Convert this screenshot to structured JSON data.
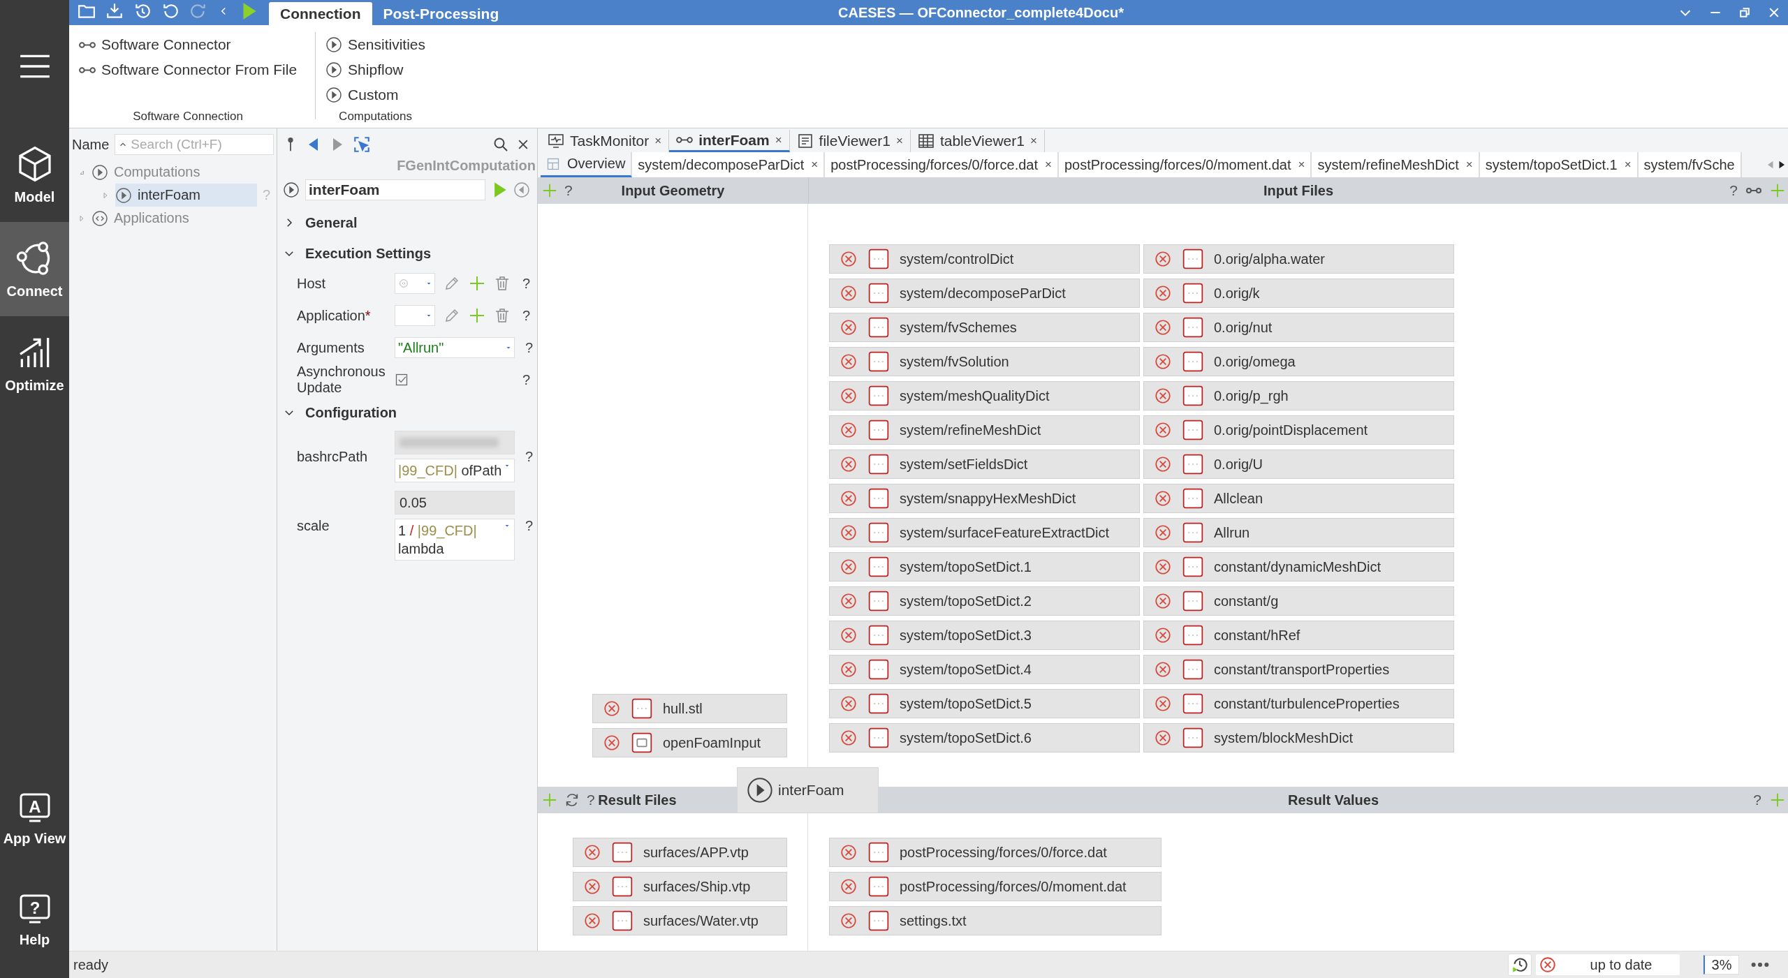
{
  "window": {
    "title": "CAESES — OFConnector_complete4Docu*"
  },
  "quick_access": [
    {
      "disabled": false
    },
    {
      "disabled": false
    },
    {
      "disabled": false
    },
    {
      "disabled": false
    },
    {
      "disabled": true
    },
    {
      "disabled": false
    },
    {
      "disabled": false
    }
  ],
  "ribbon_tabs": [
    {
      "label": "Connection",
      "selected": true
    },
    {
      "label": "Post-Processing",
      "selected": false
    }
  ],
  "ribbon_groups": [
    {
      "title": "Software Connection",
      "items": [
        {
          "label": "Software Connector"
        },
        {
          "label": "Software Connector From File"
        }
      ]
    },
    {
      "title": "Computations",
      "items": [
        {
          "label": "Sensitivities"
        },
        {
          "label": "Shipflow"
        },
        {
          "label": "Custom"
        }
      ]
    }
  ],
  "sidebar": {
    "top": [
      {
        "label": "Model",
        "selected": false
      },
      {
        "label": "Connect",
        "selected": true
      },
      {
        "label": "Optimize",
        "selected": false
      }
    ],
    "bottom": [
      {
        "label": "App View",
        "icon_text": "A",
        "selected": false
      },
      {
        "label": "Help",
        "icon_text": "?",
        "selected": false
      }
    ]
  },
  "tree": {
    "column": "Name",
    "search_placeholder": "Search (Ctrl+F)",
    "help": "?",
    "items": [
      {
        "label": "Computations",
        "kind": "computation",
        "expanded": true,
        "selected": false,
        "children": [
          {
            "label": "interFoam",
            "kind": "computation",
            "expanded": false,
            "selected": true
          }
        ]
      },
      {
        "label": "Applications",
        "kind": "application",
        "expanded": false,
        "selected": false
      }
    ]
  },
  "properties": {
    "type_label": "FGenIntComputation",
    "name": "interFoam",
    "sections": [
      {
        "title": "General",
        "expanded": false
      },
      {
        "title": "Execution Settings",
        "expanded": true,
        "rows": [
          {
            "kind": "host-select",
            "label": "Host",
            "help": "?"
          },
          {
            "kind": "select",
            "label": "Application",
            "required_mark": "*",
            "help": "?"
          },
          {
            "kind": "text",
            "label": "Arguments",
            "value": "\"Allrun\"",
            "help": "?"
          },
          {
            "kind": "checkbox",
            "label": "Asynchronous Update",
            "checked": true,
            "help": "?"
          }
        ]
      },
      {
        "title": "Configuration",
        "expanded": true,
        "rows": [
          {
            "kind": "expression",
            "label": "bashrcPath",
            "preview_hidden": true,
            "parts": [
              {
                "kind": "reference",
                "text": "|99_CFD|"
              },
              {
                "kind": "plain",
                "text": "ofPath"
              }
            ],
            "help": "?"
          },
          {
            "kind": "expression",
            "label": "scale",
            "preview_hidden": false,
            "preview": "0.05",
            "parts": [
              {
                "kind": "plain",
                "text": "1"
              },
              {
                "kind": "operator",
                "text": "/"
              },
              {
                "kind": "reference",
                "text": "|99_CFD|"
              },
              {
                "kind": "plain",
                "text": "lambda"
              }
            ],
            "help": "?"
          }
        ]
      }
    ]
  },
  "editor_tabs": [
    {
      "label": "TaskMonitor",
      "kind": "monitor",
      "selected": false,
      "close": "×"
    },
    {
      "label": "interFoam",
      "kind": "connector",
      "selected": true,
      "close": "×"
    },
    {
      "label": "fileViewer1",
      "kind": "file",
      "selected": false,
      "close": "×"
    },
    {
      "label": "tableViewer1",
      "kind": "table",
      "selected": false,
      "close": "×"
    }
  ],
  "view_tabs": [
    {
      "label": "Overview",
      "kind": "overview",
      "selected": true
    },
    {
      "label": "system/decomposeParDict",
      "selected": false,
      "close": "×"
    },
    {
      "label": "postProcessing/forces/0/force.dat",
      "selected": false,
      "close": "×"
    },
    {
      "label": "postProcessing/forces/0/moment.dat",
      "selected": false,
      "close": "×"
    },
    {
      "label": "system/refineMeshDict",
      "selected": false,
      "close": "×"
    },
    {
      "label": "system/topoSetDict.1",
      "selected": false,
      "close": "×"
    },
    {
      "label": "system/fvSche",
      "selected": false
    }
  ],
  "input_geometry": {
    "title": "Input Geometry",
    "help": "?",
    "items": [
      {
        "label": "hull.stl",
        "kind": "file"
      },
      {
        "label": "openFoamInput",
        "kind": "object"
      }
    ]
  },
  "input_files": {
    "title": "Input Files",
    "help": "?",
    "items": [
      {
        "label": "system/controlDict"
      },
      {
        "label": "0.orig/alpha.water"
      },
      {
        "label": "system/decomposeParDict"
      },
      {
        "label": "0.orig/k"
      },
      {
        "label": "system/fvSchemes"
      },
      {
        "label": "0.orig/nut"
      },
      {
        "label": "system/fvSolution"
      },
      {
        "label": "0.orig/omega"
      },
      {
        "label": "system/meshQualityDict"
      },
      {
        "label": "0.orig/p_rgh"
      },
      {
        "label": "system/refineMeshDict"
      },
      {
        "label": "0.orig/pointDisplacement"
      },
      {
        "label": "system/setFieldsDict"
      },
      {
        "label": "0.orig/U"
      },
      {
        "label": "system/snappyHexMeshDict"
      },
      {
        "label": "Allclean"
      },
      {
        "label": "system/surfaceFeatureExtractDict"
      },
      {
        "label": "Allrun"
      },
      {
        "label": "system/topoSetDict.1"
      },
      {
        "label": "constant/dynamicMeshDict"
      },
      {
        "label": "system/topoSetDict.2"
      },
      {
        "label": "constant/g"
      },
      {
        "label": "system/topoSetDict.3"
      },
      {
        "label": "constant/hRef"
      },
      {
        "label": "system/topoSetDict.4"
      },
      {
        "label": "constant/transportProperties"
      },
      {
        "label": "system/topoSetDict.5"
      },
      {
        "label": "constant/turbulenceProperties"
      },
      {
        "label": "system/topoSetDict.6"
      },
      {
        "label": "system/blockMeshDict"
      }
    ]
  },
  "computation_node": {
    "label": "interFoam"
  },
  "result_files": {
    "title": "Result Files",
    "help": "?",
    "items": [
      {
        "label": "surfaces/APP.vtp"
      },
      {
        "label": "surfaces/Ship.vtp"
      },
      {
        "label": "surfaces/Water.vtp"
      }
    ]
  },
  "result_values": {
    "title": "Result Values",
    "help": "?",
    "items": [
      {
        "label": "postProcessing/forces/0/force.dat"
      },
      {
        "label": "postProcessing/forces/0/moment.dat"
      },
      {
        "label": "settings.txt"
      }
    ]
  },
  "status_bar": {
    "message": "ready",
    "state": "up to date",
    "progress": "3%"
  }
}
